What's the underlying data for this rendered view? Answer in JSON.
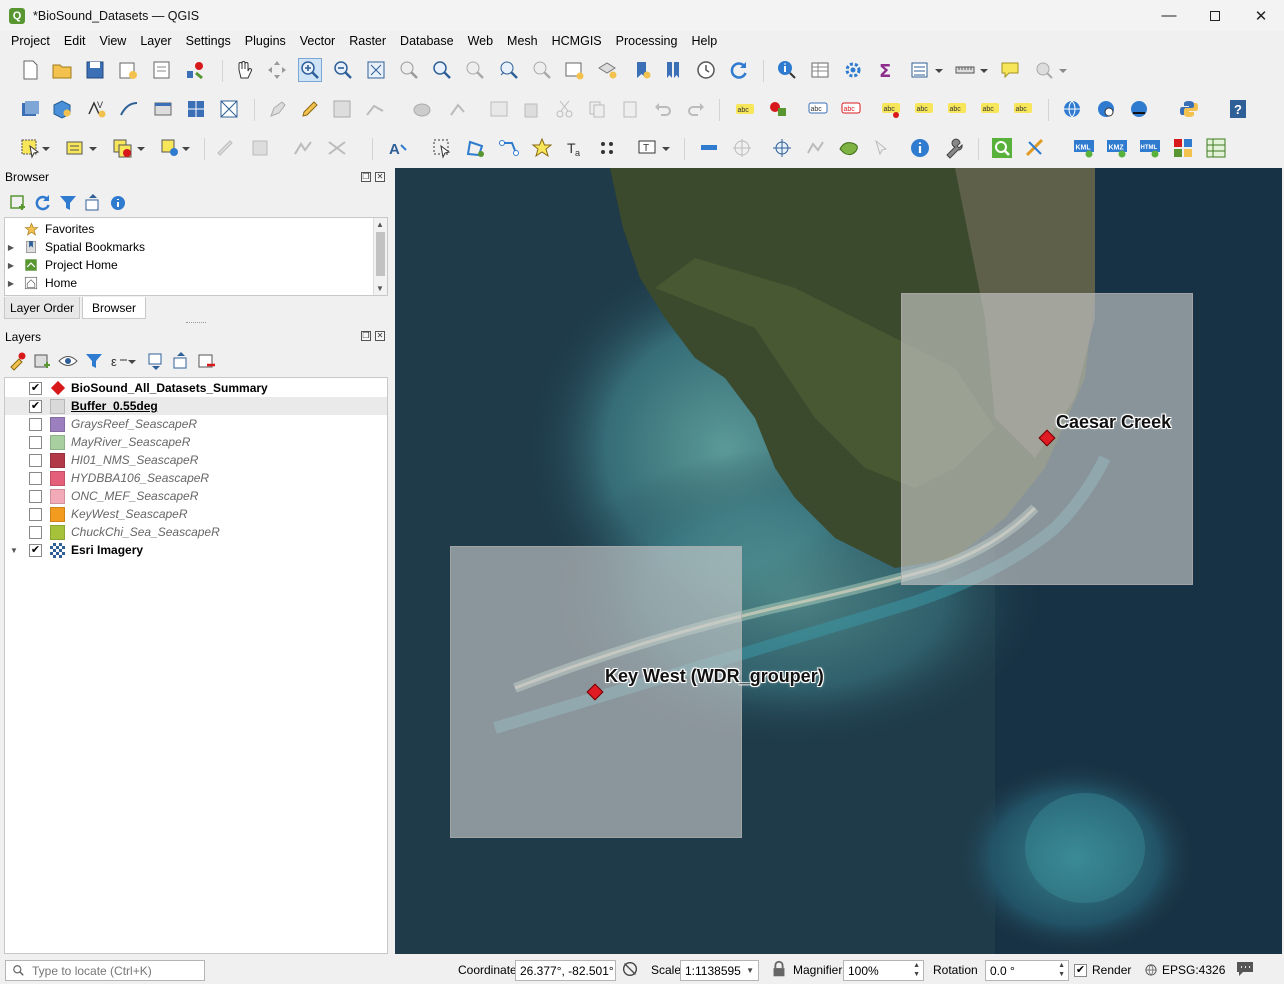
{
  "window": {
    "title": "*BioSound_Datasets — QGIS",
    "app_icon": "qgis-logo",
    "controls": [
      "minimize",
      "maximize",
      "close"
    ]
  },
  "menu": [
    "Project",
    "Edit",
    "View",
    "Layer",
    "Settings",
    "Plugins",
    "Vector",
    "Raster",
    "Database",
    "Web",
    "Mesh",
    "HCMGIS",
    "Processing",
    "Help"
  ],
  "browser_panel": {
    "title": "Browser",
    "items": [
      {
        "label": "Favorites",
        "icon": "star-icon",
        "expandable": false
      },
      {
        "label": "Spatial Bookmarks",
        "icon": "bookmark-icon",
        "expandable": true
      },
      {
        "label": "Project Home",
        "icon": "project-home-icon",
        "expandable": true
      },
      {
        "label": "Home",
        "icon": "home-icon",
        "expandable": true
      }
    ]
  },
  "tabs": [
    "Layer Order",
    "Browser"
  ],
  "active_tab": "Browser",
  "layers_panel": {
    "title": "Layers",
    "layers": [
      {
        "name": "BioSound_All_Datasets_Summary",
        "checked": true,
        "color": "#d7191c",
        "symbol": "diamond",
        "style": "bold"
      },
      {
        "name": "Buffer_0.55deg",
        "checked": true,
        "color": "#d9d9d9",
        "symbol": "fill",
        "style": "bold-underline"
      },
      {
        "name": "GraysReef_SeascapeR",
        "checked": false,
        "color": "#9b7fbf",
        "symbol": "fill",
        "style": "inactive"
      },
      {
        "name": "MayRiver_SeascapeR",
        "checked": false,
        "color": "#a8cfa0",
        "symbol": "fill",
        "style": "inactive"
      },
      {
        "name": "HI01_NMS_SeascapeR",
        "checked": false,
        "color": "#b23a48",
        "symbol": "fill",
        "style": "inactive"
      },
      {
        "name": "HYDBBA106_SeascapeR",
        "checked": false,
        "color": "#e4607a",
        "symbol": "fill",
        "style": "inactive"
      },
      {
        "name": "ONC_MEF_SeascapeR",
        "checked": false,
        "color": "#f2aab8",
        "symbol": "fill",
        "style": "inactive"
      },
      {
        "name": "KeyWest_SeascapeR",
        "checked": false,
        "color": "#f39b1f",
        "symbol": "fill",
        "style": "inactive"
      },
      {
        "name": "ChuckChi_Sea_SeascapeR",
        "checked": false,
        "color": "#a6c23a",
        "symbol": "fill",
        "style": "inactive"
      },
      {
        "name": "Esri Imagery",
        "checked": true,
        "color": "#333333",
        "symbol": "raster",
        "style": "bold",
        "expanded": true
      }
    ]
  },
  "map": {
    "labels": {
      "caesar": "Caesar Creek",
      "keywest": "Key West (WDR_grouper)"
    },
    "marker_color": "#e01b24",
    "buffer_color": "#cecece"
  },
  "status": {
    "locator_placeholder": "Type to locate (Ctrl+K)",
    "coordinate_label": "Coordinate",
    "coordinate_value": "26.377°, -82.501°",
    "scale_label": "Scale",
    "scale_value": "1:1138595",
    "magnifier_label": "Magnifier",
    "magnifier_value": "100%",
    "rotation_label": "Rotation",
    "rotation_value": "0.0 °",
    "render_label": "Render",
    "render_checked": true,
    "crs": "EPSG:4326"
  }
}
